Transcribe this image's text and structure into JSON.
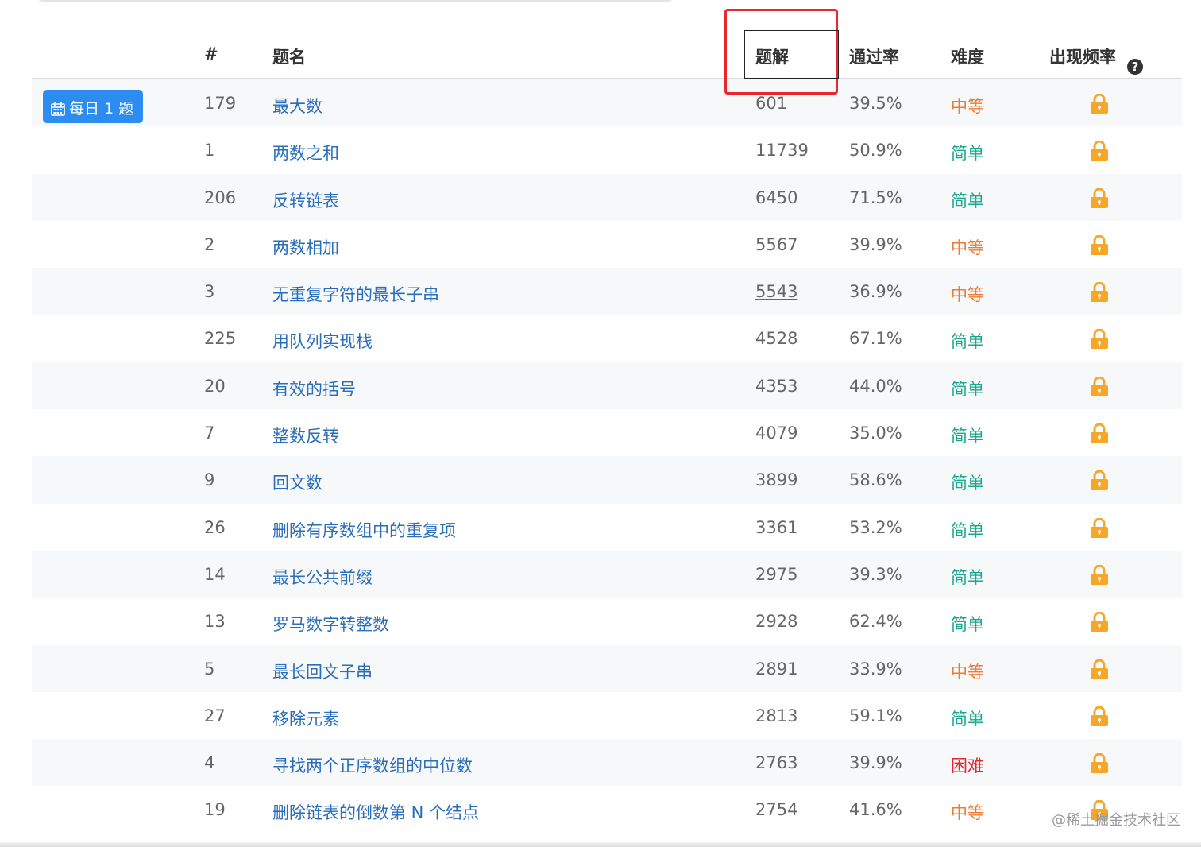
{
  "header": {
    "num": "#",
    "title": "题名",
    "solutions": "题解",
    "acceptance": "通过率",
    "difficulty": "难度",
    "frequency": "出现频率",
    "help_icon": "question-circle-icon"
  },
  "daily_badge": {
    "label": "每日 1 题",
    "icon": "calendar-icon"
  },
  "colors": {
    "medium": "#ee7b33",
    "easy": "#1aa78d",
    "hard": "#e3272d",
    "title_link": "#2a6ebb",
    "lock": "#f7a727",
    "badge": "#2d8cf0",
    "highlight": "#e8282b"
  },
  "rows": [
    {
      "num": "179",
      "title": "最大数",
      "solutions": "601",
      "rate": "39.5%",
      "difficulty": "中等",
      "level": "medium"
    },
    {
      "num": "1",
      "title": "两数之和",
      "solutions": "11739",
      "rate": "50.9%",
      "difficulty": "简单",
      "level": "easy"
    },
    {
      "num": "206",
      "title": "反转链表",
      "solutions": "6450",
      "rate": "71.5%",
      "difficulty": "简单",
      "level": "easy"
    },
    {
      "num": "2",
      "title": "两数相加",
      "solutions": "5567",
      "rate": "39.9%",
      "difficulty": "中等",
      "level": "medium"
    },
    {
      "num": "3",
      "title": "无重复字符的最长子串",
      "solutions": "5543",
      "rate": "36.9%",
      "difficulty": "中等",
      "level": "medium"
    },
    {
      "num": "225",
      "title": "用队列实现栈",
      "solutions": "4528",
      "rate": "67.1%",
      "difficulty": "简单",
      "level": "easy"
    },
    {
      "num": "20",
      "title": "有效的括号",
      "solutions": "4353",
      "rate": "44.0%",
      "difficulty": "简单",
      "level": "easy"
    },
    {
      "num": "7",
      "title": "整数反转",
      "solutions": "4079",
      "rate": "35.0%",
      "difficulty": "简单",
      "level": "easy"
    },
    {
      "num": "9",
      "title": "回文数",
      "solutions": "3899",
      "rate": "58.6%",
      "difficulty": "简单",
      "level": "easy"
    },
    {
      "num": "26",
      "title": "删除有序数组中的重复项",
      "solutions": "3361",
      "rate": "53.2%",
      "difficulty": "简单",
      "level": "easy"
    },
    {
      "num": "14",
      "title": "最长公共前缀",
      "solutions": "2975",
      "rate": "39.3%",
      "difficulty": "简单",
      "level": "easy"
    },
    {
      "num": "13",
      "title": "罗马数字转整数",
      "solutions": "2928",
      "rate": "62.4%",
      "difficulty": "简单",
      "level": "easy"
    },
    {
      "num": "5",
      "title": "最长回文子串",
      "solutions": "2891",
      "rate": "33.9%",
      "difficulty": "中等",
      "level": "medium"
    },
    {
      "num": "27",
      "title": "移除元素",
      "solutions": "2813",
      "rate": "59.1%",
      "difficulty": "简单",
      "level": "easy"
    },
    {
      "num": "4",
      "title": "寻找两个正序数组的中位数",
      "solutions": "2763",
      "rate": "39.9%",
      "difficulty": "困难",
      "level": "hard"
    },
    {
      "num": "19",
      "title": "删除链表的倒数第 N 个结点",
      "solutions": "2754",
      "rate": "41.6%",
      "difficulty": "中等",
      "level": "medium"
    }
  ],
  "watermark": "@稀土掘金技术社区"
}
